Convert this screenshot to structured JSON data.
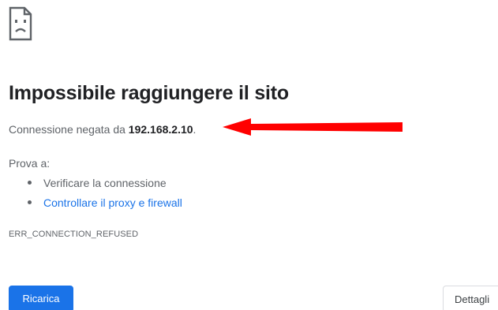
{
  "error_page": {
    "icon": "sad-page-icon",
    "title": "Impossibile raggiungere il sito",
    "summary_prefix": "Connessione negata da ",
    "summary_host": "192.168.2.10",
    "summary_suffix": ".",
    "try_label": "Prova a:",
    "suggestions": [
      {
        "label": "Verificare la connessione",
        "is_link": false
      },
      {
        "label": "Controllare il proxy e firewall",
        "is_link": true
      }
    ],
    "error_code": "ERR_CONNECTION_REFUSED",
    "reload_label": "Ricarica",
    "details_label": "Dettagli"
  },
  "annotation": {
    "arrow_color": "#ff0000"
  },
  "colors": {
    "link": "#1a73e8",
    "primary_button": "#1a73e8",
    "text_primary": "#202124",
    "text_secondary": "#5f6368"
  }
}
